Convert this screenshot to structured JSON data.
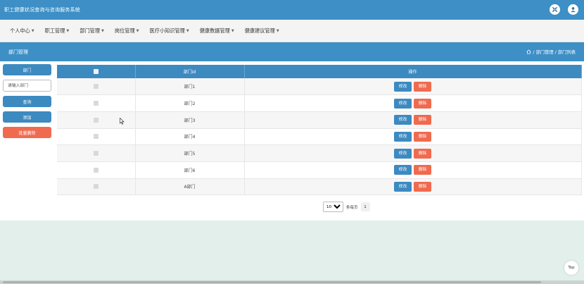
{
  "header": {
    "app_title": "职工健康状况查询与咨询服务系统",
    "icons": [
      "settings-icon",
      "user-icon"
    ]
  },
  "nav": {
    "items": [
      {
        "label": "个人中心"
      },
      {
        "label": "职工管理"
      },
      {
        "label": "部门管理"
      },
      {
        "label": "岗位管理"
      },
      {
        "label": "医疗小知识管理"
      },
      {
        "label": "健康数据管理"
      },
      {
        "label": "健康建议管理"
      }
    ]
  },
  "breadcrumb": {
    "page_title": "部门管理",
    "home_icon": "home-icon",
    "path": " / 部门管理 / 部门列表"
  },
  "sidebar": {
    "field_label": "部门",
    "input_placeholder": "请输入部门",
    "search_label": "查询",
    "add_label": "添加",
    "batch_delete_label": "批量删除"
  },
  "table": {
    "columns": [
      "",
      "部门id",
      "操作"
    ],
    "rows": [
      {
        "name": "部门1"
      },
      {
        "name": "部门2"
      },
      {
        "name": "部门3"
      },
      {
        "name": "部门4"
      },
      {
        "name": "部门5"
      },
      {
        "name": "部门6"
      },
      {
        "name": "A部门"
      }
    ],
    "edit_label": "修改",
    "delete_label": "删除"
  },
  "pagination": {
    "page_size": "10",
    "page_size_options": [
      "10"
    ],
    "per_page_label": "条每页",
    "current_page": "1"
  },
  "back_to_top": "Top",
  "colors": {
    "primary": "#3d8fc6",
    "danger": "#f06a4f",
    "page_bg": "#e3efeb"
  }
}
